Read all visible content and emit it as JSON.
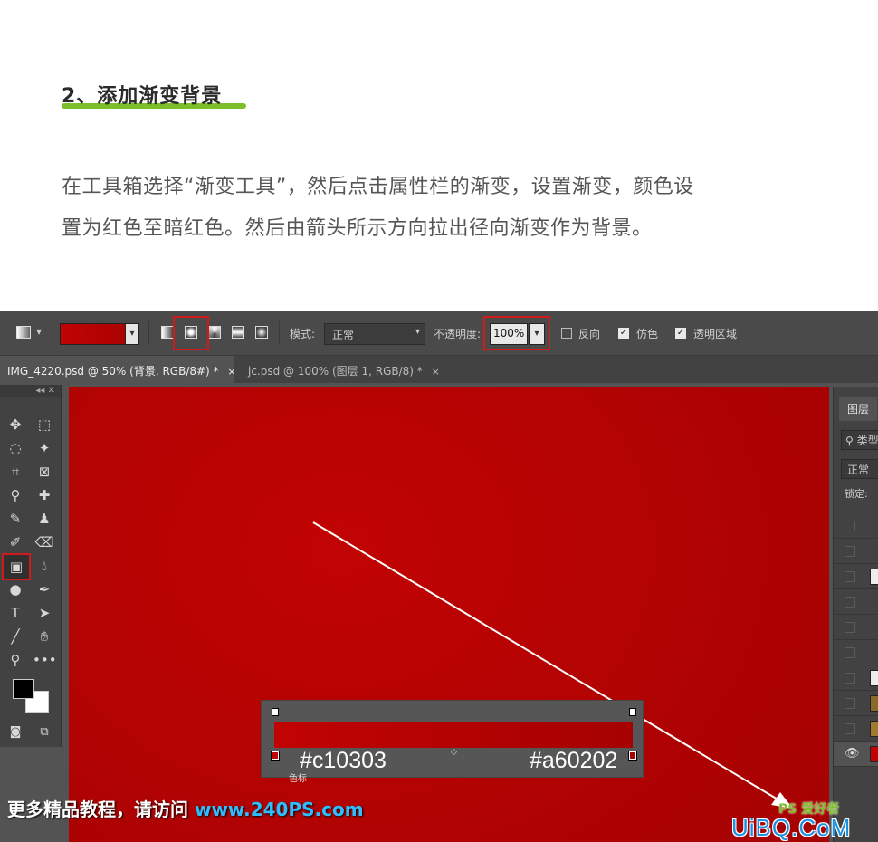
{
  "article": {
    "heading": "2、添加渐变背景",
    "paragraph_line1": "在工具箱选择“渐变工具”，然后点击属性栏的渐变，设置渐变，颜色设",
    "paragraph_line2": "置为红色至暗红色。然后由箭头所示方向拉出径向渐变作为背景。"
  },
  "options_bar": {
    "mode_label": "模式:",
    "mode_value": "正常",
    "opacity_label": "不透明度:",
    "opacity_value": "100%",
    "reverse_label": "反向",
    "dither_label": "仿色",
    "transparency_label": "透明区域",
    "gradient_types": [
      "linear",
      "radial",
      "angle",
      "reflected",
      "diamond"
    ],
    "selected_gradient_type": "radial"
  },
  "tabs": [
    {
      "label": "IMG_4220.psd @ 50% (背景, RGB/8#) *",
      "close": "×"
    },
    {
      "label": "jc.psd @ 100% (图层 1, RGB/8) *",
      "close": "×"
    }
  ],
  "toolbox": {
    "collapse_label": "◂◂ ✕",
    "active_tool": "gradient-tool",
    "tools": [
      "move",
      "marquee",
      "lasso",
      "magic-wand",
      "crop",
      "frame",
      "eyedropper",
      "healing",
      "brush",
      "stamp",
      "history-brush",
      "eraser",
      "gradient",
      "blur",
      "dodge",
      "pen",
      "type",
      "path-select",
      "line",
      "hand",
      "zoom",
      "more"
    ]
  },
  "layers_panel": {
    "tab_label": "图层",
    "search_placeholder": "类型",
    "blend_mode": "正常",
    "lock_label": "锁定:"
  },
  "gradient_editor": {
    "left_color": "#c10303",
    "right_color": "#a60202",
    "stop_label": "色标"
  },
  "colors": {
    "gradient_start": "#c10303",
    "gradient_end": "#a60202",
    "highlight": "#d11b1b",
    "heading_underline": "#7cbf2a"
  },
  "watermarks": {
    "promo_text": "更多精品教程，请访问 ",
    "promo_url": "www.240PS.com",
    "logo": "UiBQ.CoM",
    "ps_logo": "PS 爱好者"
  }
}
